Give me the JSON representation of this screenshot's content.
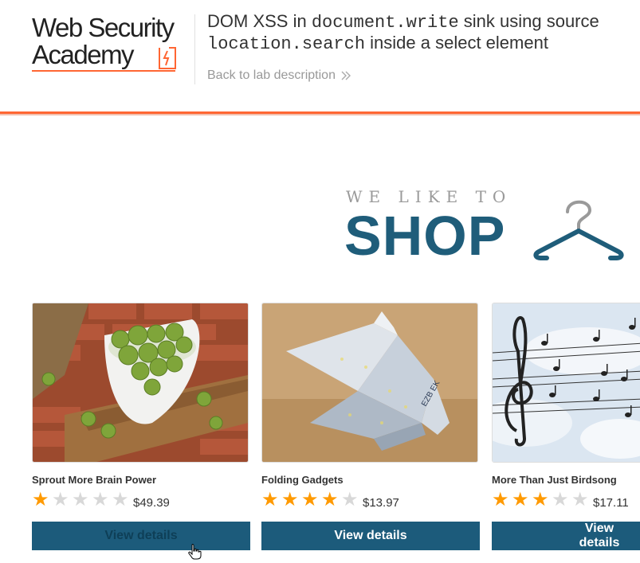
{
  "header": {
    "logo_line1": "Web Security",
    "logo_line2": "Academy",
    "title_part1": "DOM XSS in ",
    "title_code1": "document.write",
    "title_part2": " sink using source",
    "title_code2": "location.search",
    "title_part3": " inside a select element",
    "back_link": "Back to lab description",
    "accent_color": "#ff6633"
  },
  "banner": {
    "small_text": "WE LIKE TO",
    "big_text": "SHOP",
    "icon": "hanger-icon",
    "color": "#1f5d7a"
  },
  "products": [
    {
      "name": "Sprout More Brain Power",
      "rating": 1,
      "price": "$49.39",
      "button_label": "View details",
      "image": "brussels-sprouts-image"
    },
    {
      "name": "Folding Gadgets",
      "rating": 4,
      "price": "$13.97",
      "button_label": "View details",
      "image": "origami-bird-image"
    },
    {
      "name": "More Than Just Birdsong",
      "rating": 3,
      "price": "$17.11",
      "button_label": "View details",
      "image": "music-notes-sky-image"
    }
  ]
}
